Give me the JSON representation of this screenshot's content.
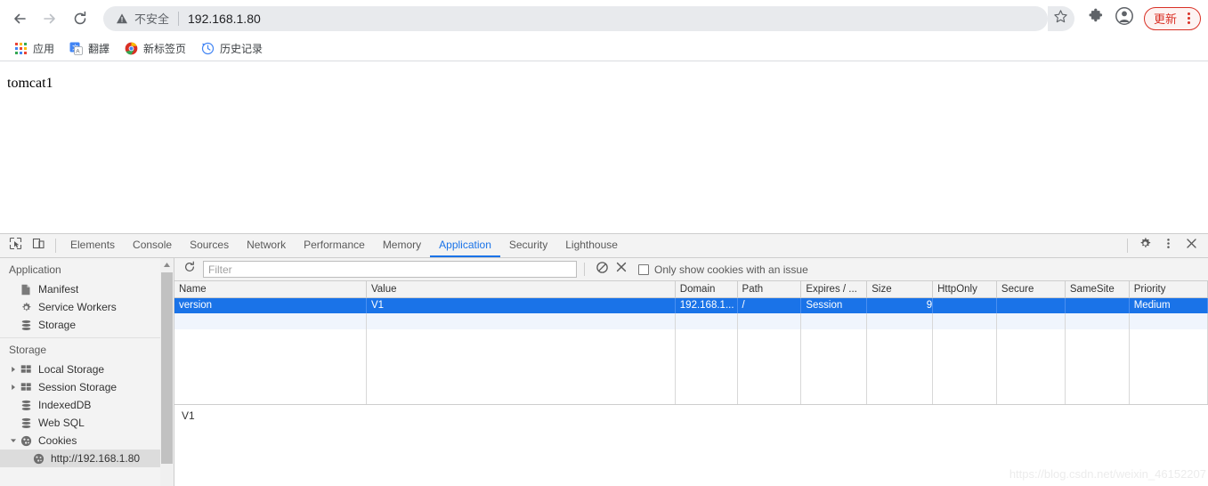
{
  "browser": {
    "nav": {
      "back_icon": "arrow-left-icon",
      "forward_icon": "arrow-right-icon",
      "reload_icon": "reload-icon"
    },
    "omnibox": {
      "security_icon": "warning-triangle-icon",
      "security_label": "不安全",
      "url": "192.168.1.80"
    },
    "toolbar_right": {
      "bookmark_icon": "star-icon",
      "extensions_icon": "puzzle-piece-icon",
      "profile_icon": "profile-avatar-icon",
      "update_label": "更新",
      "menu_icon": "three-dots-vertical-icon"
    },
    "bookmarks": [
      {
        "label": "应用",
        "icon": "apps-grid-icon"
      },
      {
        "label": "翻譯",
        "icon": "translate-icon"
      },
      {
        "label": "新标签页",
        "icon": "chrome-logo-icon"
      },
      {
        "label": "历史记录",
        "icon": "history-clock-icon"
      }
    ]
  },
  "page": {
    "body_text": "tomcat1"
  },
  "devtools": {
    "inspect_icon": "inspect-element-icon",
    "device_toolbar_icon": "device-toolbar-icon",
    "tabs": [
      {
        "label": "Elements",
        "active": false
      },
      {
        "label": "Console",
        "active": false
      },
      {
        "label": "Sources",
        "active": false
      },
      {
        "label": "Network",
        "active": false
      },
      {
        "label": "Performance",
        "active": false
      },
      {
        "label": "Memory",
        "active": false
      },
      {
        "label": "Application",
        "active": true
      },
      {
        "label": "Security",
        "active": false
      },
      {
        "label": "Lighthouse",
        "active": false
      }
    ],
    "right_icons": {
      "settings_icon": "gear-icon",
      "more_icon": "three-dots-vertical-icon",
      "close_icon": "close-x-icon"
    },
    "sidebar": {
      "section_application": "Application",
      "application_items": [
        {
          "label": "Manifest",
          "icon": "document-icon"
        },
        {
          "label": "Service Workers",
          "icon": "gear-icon"
        },
        {
          "label": "Storage",
          "icon": "database-icon"
        }
      ],
      "section_storage": "Storage",
      "storage_items": [
        {
          "label": "Local Storage",
          "icon": "table-grid-icon",
          "expandable": true,
          "expanded": false
        },
        {
          "label": "Session Storage",
          "icon": "table-grid-icon",
          "expandable": true,
          "expanded": false
        },
        {
          "label": "IndexedDB",
          "icon": "database-icon",
          "expandable": false,
          "expanded": false
        },
        {
          "label": "Web SQL",
          "icon": "database-icon",
          "expandable": false,
          "expanded": false
        },
        {
          "label": "Cookies",
          "icon": "cookie-icon",
          "expandable": true,
          "expanded": true
        }
      ],
      "cookie_origin": {
        "label": "http://192.168.1.80",
        "icon": "cookie-icon",
        "selected": true
      }
    },
    "cookie_toolbar": {
      "refresh_icon": "refresh-icon",
      "filter_placeholder": "Filter",
      "filter_value": "",
      "clear_all_icon": "clear-all-circle-slash-icon",
      "delete_icon": "delete-x-icon",
      "issue_checkbox_label": "Only show cookies with an issue",
      "issue_checkbox_checked": false
    },
    "cookie_table": {
      "columns": [
        "Name",
        "Value",
        "Domain",
        "Path",
        "Expires / ...",
        "Size",
        "HttpOnly",
        "Secure",
        "SameSite",
        "Priority"
      ],
      "rows": [
        {
          "selected": true,
          "Name": "version",
          "Value": "V1",
          "Domain": "192.168.1...",
          "Path": "/",
          "Expires": "Session",
          "Size": "9",
          "HttpOnly": "",
          "Secure": "",
          "SameSite": "",
          "Priority": "Medium"
        }
      ]
    },
    "cookie_preview": {
      "value": "V1"
    }
  },
  "watermark": {
    "text": "https://blog.csdn.net/weixin_46152207"
  },
  "colors": {
    "accent_blue": "#1a73e8",
    "warning_red": "#d93025",
    "chrome_grey": "#e8eaed"
  }
}
